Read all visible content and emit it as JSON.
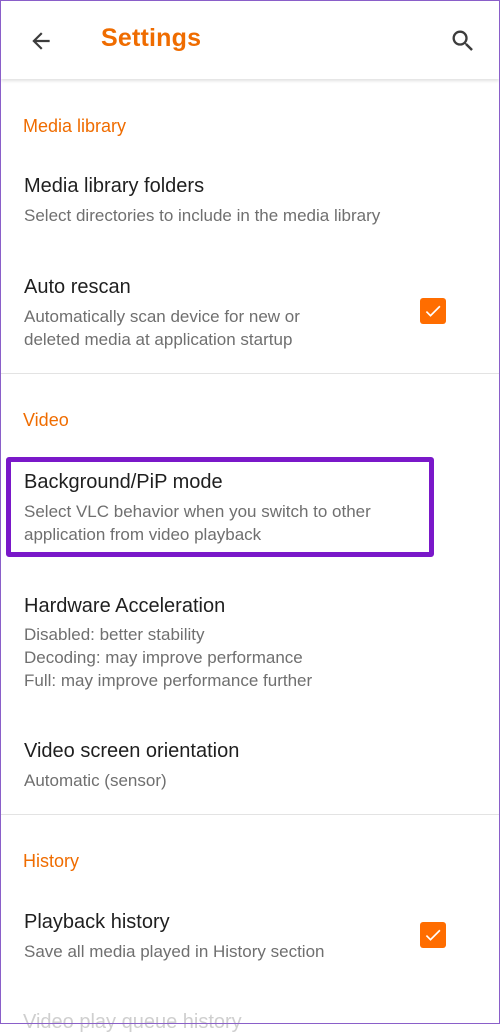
{
  "appbar": {
    "title": "Settings",
    "back_icon": "arrow-back-icon",
    "search_icon": "search-icon"
  },
  "colors": {
    "accent": "#ef6c00",
    "checkbox": "#ff6d00",
    "highlight": "#7a18c9"
  },
  "sections": {
    "media_library": {
      "header": "Media library",
      "folders": {
        "title": "Media library folders",
        "subtitle": "Select directories to include in the media library"
      },
      "auto_rescan": {
        "title": "Auto rescan",
        "subtitle_line1": "Automatically scan device for new or",
        "subtitle_line2": "deleted media at application startup",
        "checked": true
      }
    },
    "video": {
      "header": "Video",
      "pip": {
        "title": "Background/PiP mode",
        "subtitle_line1": "Select VLC behavior when you switch to other",
        "subtitle_line2": "application from video playback"
      },
      "hw_accel": {
        "title": "Hardware Acceleration",
        "line1": "Disabled: better stability",
        "line2": "Decoding: may improve performance",
        "line3": "Full: may improve performance further"
      },
      "orientation": {
        "title": "Video screen orientation",
        "subtitle": "Automatic (sensor)"
      }
    },
    "history": {
      "header": "History",
      "playback": {
        "title": "Playback history",
        "subtitle": "Save all media played in History section",
        "checked": true
      },
      "next_item_partial": "Video play queue history"
    }
  }
}
